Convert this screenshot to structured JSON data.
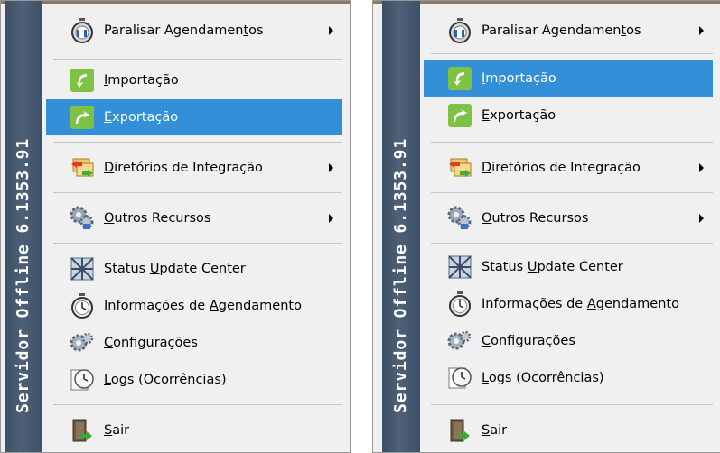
{
  "sidebar_title": "Servidor Offline 6.1353.91",
  "items": {
    "paralisar": {
      "pre": "Paralisar Agendamen",
      "ul": "t",
      "post": "os"
    },
    "importacao": {
      "pre": "",
      "ul": "I",
      "post": "mportação"
    },
    "exportacao": {
      "pre": "",
      "ul": "E",
      "post": "xportação"
    },
    "diretorios": {
      "pre": "",
      "ul": "D",
      "post": "iretórios de Integração"
    },
    "outros": {
      "pre": "",
      "ul": "O",
      "post": "utros Recursos"
    },
    "status": {
      "pre": "Status ",
      "ul": "U",
      "post": "pdate Center"
    },
    "informacoes": {
      "pre": "Informações de ",
      "ul": "A",
      "post": "gendamento"
    },
    "configuracoes": {
      "pre": "",
      "ul": "C",
      "post": "onfigurações"
    },
    "logs": {
      "pre": "",
      "ul": "L",
      "post": "ogs (Ocorrências)"
    },
    "sair": {
      "pre": "",
      "ul": "S",
      "post": "air"
    }
  },
  "left_menu_highlight": "Exportação",
  "right_menu_highlight": "Importação",
  "colors": {
    "highlight": "#3390d8",
    "sidebar": "#455a72",
    "menu_bg": "#f0f0f0"
  },
  "icons": [
    "stopwatch-icon",
    "import-arrow-icon",
    "export-arrow-icon",
    "folders-icon",
    "gears-icon",
    "network-icon",
    "stopwatch-icon",
    "gears-icon",
    "clock-log-icon",
    "exit-door-icon"
  ]
}
